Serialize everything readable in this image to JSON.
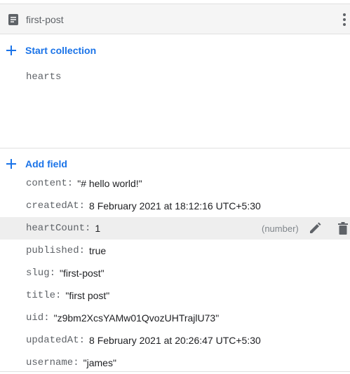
{
  "document": {
    "title": "first-post"
  },
  "collections": {
    "start_label": "Start collection",
    "items": [
      "hearts"
    ]
  },
  "fields": {
    "add_label": "Add field",
    "rows": [
      {
        "key": "content:",
        "value": "\"# hello world!\""
      },
      {
        "key": "createdAt:",
        "value": "8 February 2021 at 18:12:16 UTC+5:30"
      },
      {
        "key": "heartCount:",
        "value": "1",
        "type": "(number)"
      },
      {
        "key": "published:",
        "value": "true"
      },
      {
        "key": "slug:",
        "value": "\"first-post\""
      },
      {
        "key": "title:",
        "value": "\"first post\""
      },
      {
        "key": "uid:",
        "value": "\"z9bm2XcsYAMw01QvozUHTrajlU73\""
      },
      {
        "key": "updatedAt:",
        "value": "8 February 2021 at 20:26:47 UTC+5:30"
      },
      {
        "key": "username:",
        "value": "\"james\""
      }
    ]
  },
  "colors": {
    "accent": "#1a73e8",
    "key_text": "#5f6368",
    "highlight_row": "#eeeeee"
  },
  "icons": [
    "document-icon",
    "more-vert-icon",
    "plus-icon",
    "edit-icon",
    "trash-icon"
  ]
}
